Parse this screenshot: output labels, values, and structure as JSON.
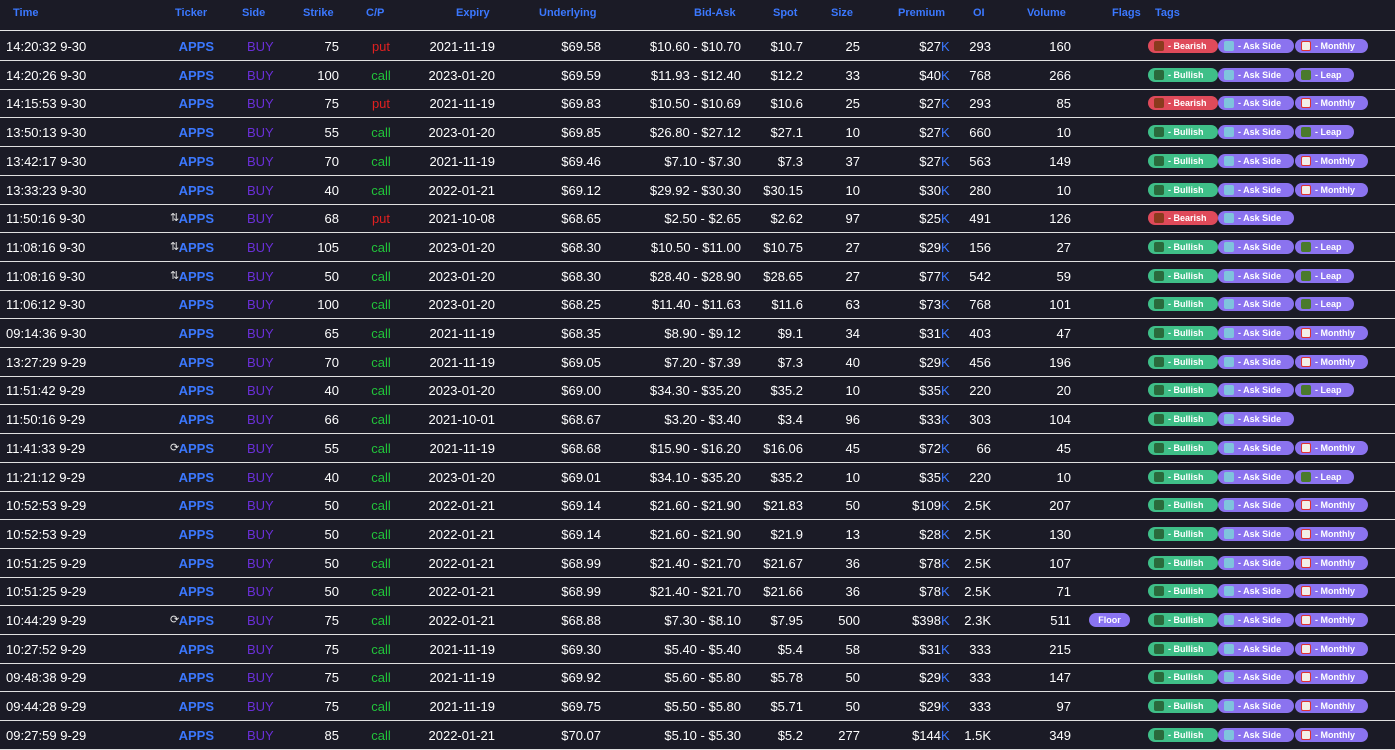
{
  "columns": {
    "time": "Time",
    "ticker": "Ticker",
    "side": "Side",
    "strike": "Strike",
    "cp": "C/P",
    "expiry": "Expiry",
    "underlying": "Underlying",
    "bidask": "Bid-Ask",
    "spot": "Spot",
    "size": "Size",
    "premium": "Premium",
    "oi": "OI",
    "volume": "Volume",
    "flags": "Flags",
    "tags": "Tags"
  },
  "premium_suffix": "K",
  "tag_labels": {
    "bullish": " - Bullish",
    "bearish": " - Bearish",
    "ask": " - Ask Side",
    "monthly": " - Monthly",
    "leap": " - Leap"
  },
  "colors": {
    "background": "#1b1b26",
    "accent_blue": "#3b78ff",
    "buy_purple": "#6a2fd8",
    "put_red": "#e02020",
    "call_green": "#21c43a",
    "bullish_tag": "#3fbf88",
    "bearish_tag": "#df4a5a",
    "ask_tag": "#8b73ef"
  },
  "icons": {
    "bullish": "bull-icon",
    "bearish": "bear-icon",
    "ask": "chart-icon",
    "monthly": "calendar-icon",
    "leap": "turtle-icon",
    "sweep": "sweep-arrows-icon",
    "repeat": "repeat-icon"
  },
  "rows": [
    {
      "time": "14:20:32 9-30",
      "ticker": "APPS",
      "side": "BUY",
      "strike": "75",
      "cp": "put",
      "expiry": "2021-11-19",
      "underlying": "$69.58",
      "bidask": "$10.60 - $10.70",
      "spot": "$10.7",
      "size": "25",
      "premium": "$27",
      "oi": "293",
      "volume": "160",
      "flag": "",
      "mark": "",
      "tags": [
        "bearish",
        "ask",
        "monthly"
      ]
    },
    {
      "time": "14:20:26 9-30",
      "ticker": "APPS",
      "side": "BUY",
      "strike": "100",
      "cp": "call",
      "expiry": "2023-01-20",
      "underlying": "$69.59",
      "bidask": "$11.93 - $12.40",
      "spot": "$12.2",
      "size": "33",
      "premium": "$40",
      "oi": "768",
      "volume": "266",
      "flag": "",
      "mark": "",
      "tags": [
        "bullish",
        "ask",
        "leap"
      ]
    },
    {
      "time": "14:15:53 9-30",
      "ticker": "APPS",
      "side": "BUY",
      "strike": "75",
      "cp": "put",
      "expiry": "2021-11-19",
      "underlying": "$69.83",
      "bidask": "$10.50 - $10.69",
      "spot": "$10.6",
      "size": "25",
      "premium": "$27",
      "oi": "293",
      "volume": "85",
      "flag": "",
      "mark": "",
      "tags": [
        "bearish",
        "ask",
        "monthly"
      ]
    },
    {
      "time": "13:50:13 9-30",
      "ticker": "APPS",
      "side": "BUY",
      "strike": "55",
      "cp": "call",
      "expiry": "2023-01-20",
      "underlying": "$69.85",
      "bidask": "$26.80 - $27.12",
      "spot": "$27.1",
      "size": "10",
      "premium": "$27",
      "oi": "660",
      "volume": "10",
      "flag": "",
      "mark": "",
      "tags": [
        "bullish",
        "ask",
        "leap"
      ]
    },
    {
      "time": "13:42:17 9-30",
      "ticker": "APPS",
      "side": "BUY",
      "strike": "70",
      "cp": "call",
      "expiry": "2021-11-19",
      "underlying": "$69.46",
      "bidask": "$7.10 - $7.30",
      "spot": "$7.3",
      "size": "37",
      "premium": "$27",
      "oi": "563",
      "volume": "149",
      "flag": "",
      "mark": "",
      "tags": [
        "bullish",
        "ask",
        "monthly"
      ]
    },
    {
      "time": "13:33:23 9-30",
      "ticker": "APPS",
      "side": "BUY",
      "strike": "40",
      "cp": "call",
      "expiry": "2022-01-21",
      "underlying": "$69.12",
      "bidask": "$29.92 - $30.30",
      "spot": "$30.15",
      "size": "10",
      "premium": "$30",
      "oi": "280",
      "volume": "10",
      "flag": "",
      "mark": "",
      "tags": [
        "bullish",
        "ask",
        "monthly"
      ]
    },
    {
      "time": "11:50:16 9-30",
      "ticker": "APPS",
      "side": "BUY",
      "strike": "68",
      "cp": "put",
      "expiry": "2021-10-08",
      "underlying": "$68.65",
      "bidask": "$2.50 - $2.65",
      "spot": "$2.62",
      "size": "97",
      "premium": "$25",
      "oi": "491",
      "volume": "126",
      "flag": "",
      "mark": "⇅",
      "tags": [
        "bearish",
        "ask"
      ]
    },
    {
      "time": "11:08:16 9-30",
      "ticker": "APPS",
      "side": "BUY",
      "strike": "105",
      "cp": "call",
      "expiry": "2023-01-20",
      "underlying": "$68.30",
      "bidask": "$10.50 - $11.00",
      "spot": "$10.75",
      "size": "27",
      "premium": "$29",
      "oi": "156",
      "volume": "27",
      "flag": "",
      "mark": "⇅",
      "tags": [
        "bullish",
        "ask",
        "leap"
      ]
    },
    {
      "time": "11:08:16 9-30",
      "ticker": "APPS",
      "side": "BUY",
      "strike": "50",
      "cp": "call",
      "expiry": "2023-01-20",
      "underlying": "$68.30",
      "bidask": "$28.40 - $28.90",
      "spot": "$28.65",
      "size": "27",
      "premium": "$77",
      "oi": "542",
      "volume": "59",
      "flag": "",
      "mark": "⇅",
      "tags": [
        "bullish",
        "ask",
        "leap"
      ]
    },
    {
      "time": "11:06:12 9-30",
      "ticker": "APPS",
      "side": "BUY",
      "strike": "100",
      "cp": "call",
      "expiry": "2023-01-20",
      "underlying": "$68.25",
      "bidask": "$11.40 - $11.63",
      "spot": "$11.6",
      "size": "63",
      "premium": "$73",
      "oi": "768",
      "volume": "101",
      "flag": "",
      "mark": "",
      "tags": [
        "bullish",
        "ask",
        "leap"
      ]
    },
    {
      "time": "09:14:36 9-30",
      "ticker": "APPS",
      "side": "BUY",
      "strike": "65",
      "cp": "call",
      "expiry": "2021-11-19",
      "underlying": "$68.35",
      "bidask": "$8.90 - $9.12",
      "spot": "$9.1",
      "size": "34",
      "premium": "$31",
      "oi": "403",
      "volume": "47",
      "flag": "",
      "mark": "",
      "tags": [
        "bullish",
        "ask",
        "monthly"
      ]
    },
    {
      "time": "13:27:29 9-29",
      "ticker": "APPS",
      "side": "BUY",
      "strike": "70",
      "cp": "call",
      "expiry": "2021-11-19",
      "underlying": "$69.05",
      "bidask": "$7.20 - $7.39",
      "spot": "$7.3",
      "size": "40",
      "premium": "$29",
      "oi": "456",
      "volume": "196",
      "flag": "",
      "mark": "",
      "tags": [
        "bullish",
        "ask",
        "monthly"
      ]
    },
    {
      "time": "11:51:42 9-29",
      "ticker": "APPS",
      "side": "BUY",
      "strike": "40",
      "cp": "call",
      "expiry": "2023-01-20",
      "underlying": "$69.00",
      "bidask": "$34.30 - $35.20",
      "spot": "$35.2",
      "size": "10",
      "premium": "$35",
      "oi": "220",
      "volume": "20",
      "flag": "",
      "mark": "",
      "tags": [
        "bullish",
        "ask",
        "leap"
      ]
    },
    {
      "time": "11:50:16 9-29",
      "ticker": "APPS",
      "side": "BUY",
      "strike": "66",
      "cp": "call",
      "expiry": "2021-10-01",
      "underlying": "$68.67",
      "bidask": "$3.20 - $3.40",
      "spot": "$3.4",
      "size": "96",
      "premium": "$33",
      "oi": "303",
      "volume": "104",
      "flag": "",
      "mark": "",
      "tags": [
        "bullish",
        "ask"
      ]
    },
    {
      "time": "11:41:33 9-29",
      "ticker": "APPS",
      "side": "BUY",
      "strike": "55",
      "cp": "call",
      "expiry": "2021-11-19",
      "underlying": "$68.68",
      "bidask": "$15.90 - $16.20",
      "spot": "$16.06",
      "size": "45",
      "premium": "$72",
      "oi": "66",
      "volume": "45",
      "flag": "",
      "mark": "⟳",
      "tags": [
        "bullish",
        "ask",
        "monthly"
      ]
    },
    {
      "time": "11:21:12 9-29",
      "ticker": "APPS",
      "side": "BUY",
      "strike": "40",
      "cp": "call",
      "expiry": "2023-01-20",
      "underlying": "$69.01",
      "bidask": "$34.10 - $35.20",
      "spot": "$35.2",
      "size": "10",
      "premium": "$35",
      "oi": "220",
      "volume": "10",
      "flag": "",
      "mark": "",
      "tags": [
        "bullish",
        "ask",
        "leap"
      ]
    },
    {
      "time": "10:52:53 9-29",
      "ticker": "APPS",
      "side": "BUY",
      "strike": "50",
      "cp": "call",
      "expiry": "2022-01-21",
      "underlying": "$69.14",
      "bidask": "$21.60 - $21.90",
      "spot": "$21.83",
      "size": "50",
      "premium": "$109",
      "oi": "2.5K",
      "volume": "207",
      "flag": "",
      "mark": "",
      "tags": [
        "bullish",
        "ask",
        "monthly"
      ]
    },
    {
      "time": "10:52:53 9-29",
      "ticker": "APPS",
      "side": "BUY",
      "strike": "50",
      "cp": "call",
      "expiry": "2022-01-21",
      "underlying": "$69.14",
      "bidask": "$21.60 - $21.90",
      "spot": "$21.9",
      "size": "13",
      "premium": "$28",
      "oi": "2.5K",
      "volume": "130",
      "flag": "",
      "mark": "",
      "tags": [
        "bullish",
        "ask",
        "monthly"
      ]
    },
    {
      "time": "10:51:25 9-29",
      "ticker": "APPS",
      "side": "BUY",
      "strike": "50",
      "cp": "call",
      "expiry": "2022-01-21",
      "underlying": "$68.99",
      "bidask": "$21.40 - $21.70",
      "spot": "$21.67",
      "size": "36",
      "premium": "$78",
      "oi": "2.5K",
      "volume": "107",
      "flag": "",
      "mark": "",
      "tags": [
        "bullish",
        "ask",
        "monthly"
      ]
    },
    {
      "time": "10:51:25 9-29",
      "ticker": "APPS",
      "side": "BUY",
      "strike": "50",
      "cp": "call",
      "expiry": "2022-01-21",
      "underlying": "$68.99",
      "bidask": "$21.40 - $21.70",
      "spot": "$21.66",
      "size": "36",
      "premium": "$78",
      "oi": "2.5K",
      "volume": "71",
      "flag": "",
      "mark": "",
      "tags": [
        "bullish",
        "ask",
        "monthly"
      ]
    },
    {
      "time": "10:44:29 9-29",
      "ticker": "APPS",
      "side": "BUY",
      "strike": "75",
      "cp": "call",
      "expiry": "2022-01-21",
      "underlying": "$68.88",
      "bidask": "$7.30 - $8.10",
      "spot": "$7.95",
      "size": "500",
      "premium": "$398",
      "oi": "2.3K",
      "volume": "511",
      "flag": "Floor",
      "mark": "⟳",
      "tags": [
        "bullish",
        "ask",
        "monthly"
      ]
    },
    {
      "time": "10:27:52 9-29",
      "ticker": "APPS",
      "side": "BUY",
      "strike": "75",
      "cp": "call",
      "expiry": "2021-11-19",
      "underlying": "$69.30",
      "bidask": "$5.40 - $5.40",
      "spot": "$5.4",
      "size": "58",
      "premium": "$31",
      "oi": "333",
      "volume": "215",
      "flag": "",
      "mark": "",
      "tags": [
        "bullish",
        "ask",
        "monthly"
      ]
    },
    {
      "time": "09:48:38 9-29",
      "ticker": "APPS",
      "side": "BUY",
      "strike": "75",
      "cp": "call",
      "expiry": "2021-11-19",
      "underlying": "$69.92",
      "bidask": "$5.60 - $5.80",
      "spot": "$5.78",
      "size": "50",
      "premium": "$29",
      "oi": "333",
      "volume": "147",
      "flag": "",
      "mark": "",
      "tags": [
        "bullish",
        "ask",
        "monthly"
      ]
    },
    {
      "time": "09:44:28 9-29",
      "ticker": "APPS",
      "side": "BUY",
      "strike": "75",
      "cp": "call",
      "expiry": "2021-11-19",
      "underlying": "$69.75",
      "bidask": "$5.50 - $5.80",
      "spot": "$5.71",
      "size": "50",
      "premium": "$29",
      "oi": "333",
      "volume": "97",
      "flag": "",
      "mark": "",
      "tags": [
        "bullish",
        "ask",
        "monthly"
      ]
    },
    {
      "time": "09:27:59 9-29",
      "ticker": "APPS",
      "side": "BUY",
      "strike": "85",
      "cp": "call",
      "expiry": "2022-01-21",
      "underlying": "$70.07",
      "bidask": "$5.10 - $5.30",
      "spot": "$5.2",
      "size": "277",
      "premium": "$144",
      "oi": "1.5K",
      "volume": "349",
      "flag": "",
      "mark": "",
      "tags": [
        "bullish",
        "ask",
        "monthly"
      ]
    }
  ]
}
